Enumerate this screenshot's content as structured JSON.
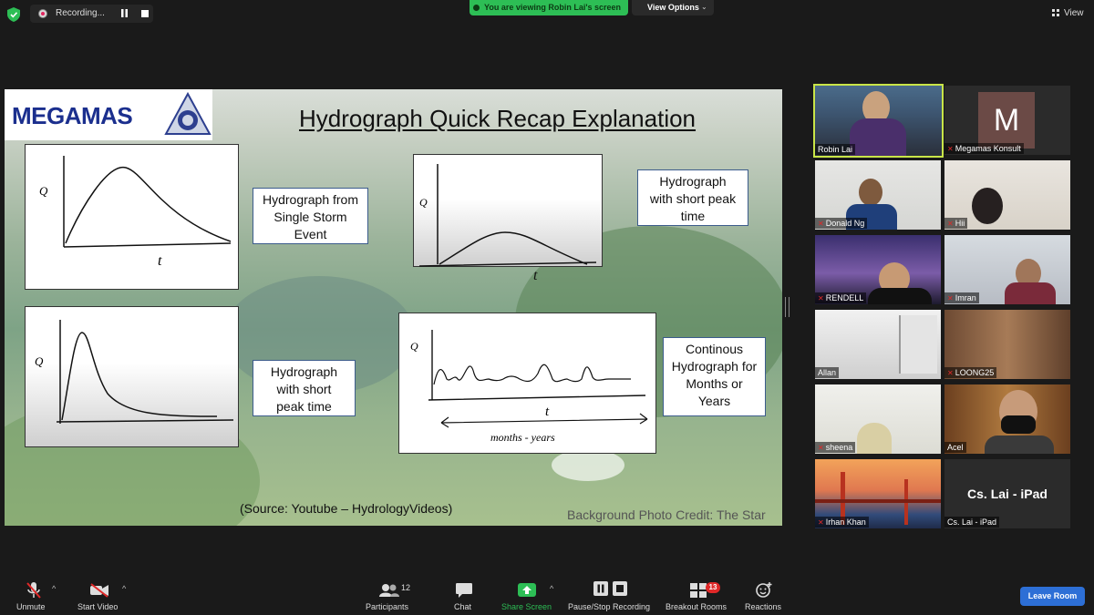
{
  "top_bar": {
    "recording_label": "Recording...",
    "viewing_banner": "You are viewing Robin Lai's screen",
    "view_options_label": "View Options",
    "view_label": "View"
  },
  "slide": {
    "logo_text": "MEGAMAS",
    "title": "Hydrograph Quick Recap Explanation",
    "captions": {
      "single_storm": [
        "Hydrograph from",
        "Single Storm",
        "Event"
      ],
      "short_peak_top": [
        "Hydrograph",
        "with short peak",
        "time"
      ],
      "short_peak_bottom": [
        "Hydrograph",
        "with short",
        "peak time"
      ],
      "continuous": [
        "Continous",
        "Hydrograph for",
        "Months or",
        "Years"
      ]
    },
    "graph_labels": {
      "q": "Q",
      "t": "t",
      "months_years": "months - years"
    },
    "source": "(Source: Youtube – HydrologyVideos)",
    "credit": "Background Photo Credit: The Star"
  },
  "participants": [
    {
      "name": "Robin Lai",
      "muted": false
    },
    {
      "name": "Megamas Konsult",
      "muted": true,
      "initial": "M"
    },
    {
      "name": "Donald Ng",
      "muted": true
    },
    {
      "name": "Hii",
      "muted": true
    },
    {
      "name": "RENDELL",
      "muted": true
    },
    {
      "name": "Imran",
      "muted": true
    },
    {
      "name": "Allan",
      "muted": true
    },
    {
      "name": "LOONG25",
      "muted": true
    },
    {
      "name": "sheena",
      "muted": true
    },
    {
      "name": "Acel",
      "muted": false
    },
    {
      "name": "Irhan Khan",
      "muted": true
    },
    {
      "name": "Cs. Lai - iPad",
      "muted": false,
      "display": "Cs. Lai - iPad"
    }
  ],
  "toolbar": {
    "unmute": "Unmute",
    "start_video": "Start Video",
    "participants": "Participants",
    "participants_count": "12",
    "chat": "Chat",
    "share_screen": "Share Screen",
    "recording": "Pause/Stop Recording",
    "breakout": "Breakout Rooms",
    "breakout_count": "13",
    "reactions": "Reactions",
    "leave": "Leave Room"
  },
  "colors": {
    "accent_green": "#2dbe55",
    "leave_blue": "#2d6fd6",
    "active_speaker": "#c9e548",
    "muted_red": "#e02828"
  }
}
